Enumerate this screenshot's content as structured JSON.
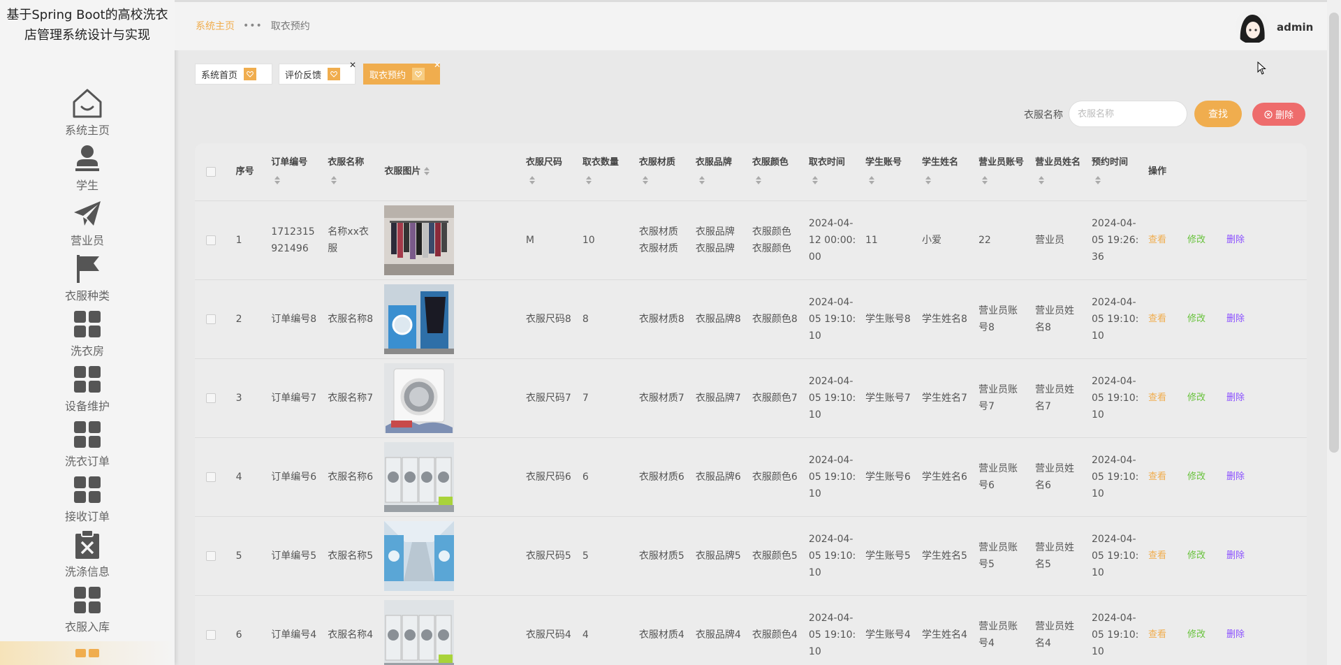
{
  "sidebar": {
    "title": "基于Spring Boot的高校洗衣店管理系统设计与实现",
    "items": [
      {
        "label": "系统主页",
        "icon": "home-icon"
      },
      {
        "label": "学生",
        "icon": "user-icon"
      },
      {
        "label": "营业员",
        "icon": "paper-plane-icon"
      },
      {
        "label": "衣服种类",
        "icon": "flag-icon"
      },
      {
        "label": "洗衣房",
        "icon": "grid-icon"
      },
      {
        "label": "设备维护",
        "icon": "grid-icon"
      },
      {
        "label": "洗衣订单",
        "icon": "grid-icon"
      },
      {
        "label": "接收订单",
        "icon": "grid-icon"
      },
      {
        "label": "洗涤信息",
        "icon": "clipboard-x-icon"
      },
      {
        "label": "衣服入库",
        "icon": "grid-icon"
      }
    ]
  },
  "header": {
    "breadcrumb_home": "系统主页",
    "breadcrumb_sep": "•••",
    "breadcrumb_current": "取衣预约",
    "username": "admin"
  },
  "tabs": [
    {
      "label": "系统首页",
      "closable": false
    },
    {
      "label": "评价反馈",
      "closable": true
    },
    {
      "label": "取衣预约",
      "closable": true,
      "active": true
    }
  ],
  "search": {
    "label": "衣服名称",
    "placeholder": "衣服名称",
    "find_label": "查找",
    "delete_label": "删除"
  },
  "table": {
    "columns": [
      "序号",
      "订单编号",
      "衣服名称",
      "衣服图片",
      "衣服尺码",
      "取衣数量",
      "衣服材质",
      "衣服品牌",
      "衣服颜色",
      "取衣时间",
      "学生账号",
      "学生姓名",
      "营业员账号",
      "营业员姓名",
      "预约时间",
      "操作"
    ],
    "actions": {
      "view": "查看",
      "edit": "修改",
      "delete": "删除"
    },
    "rows": [
      {
        "idx": "1",
        "order": "1712315921496",
        "name": "名称xx衣服",
        "img": "rack",
        "size": "M",
        "qty": "10",
        "material": "衣服材质衣服材质",
        "brand": "衣服品牌衣服品牌",
        "color": "衣服颜色衣服颜色",
        "pick": "2024-04-12 00:00:00",
        "stu_acct": "11",
        "stu_name": "小爱",
        "clerk_acct": "22",
        "clerk_name": "营业员",
        "reserve": "2024-04-05 19:26:36"
      },
      {
        "idx": "2",
        "order": "订单编号8",
        "name": "衣服名称8",
        "img": "blue-machine",
        "size": "衣服尺码8",
        "qty": "8",
        "material": "衣服材质8",
        "brand": "衣服品牌8",
        "color": "衣服颜色8",
        "pick": "2024-04-05 19:10:10",
        "stu_acct": "学生账号8",
        "stu_name": "学生姓名8",
        "clerk_acct": "营业员账号8",
        "clerk_name": "营业员姓名8",
        "reserve": "2024-04-05 19:10:10"
      },
      {
        "idx": "3",
        "order": "订单编号7",
        "name": "衣服名称7",
        "img": "white-machine",
        "size": "衣服尺码7",
        "qty": "7",
        "material": "衣服材质7",
        "brand": "衣服品牌7",
        "color": "衣服颜色7",
        "pick": "2024-04-05 19:10:10",
        "stu_acct": "学生账号7",
        "stu_name": "学生姓名7",
        "clerk_acct": "营业员账号7",
        "clerk_name": "营业员姓名7",
        "reserve": "2024-04-05 19:10:10"
      },
      {
        "idx": "4",
        "order": "订单编号6",
        "name": "衣服名称6",
        "img": "machine-row",
        "size": "衣服尺码6",
        "qty": "6",
        "material": "衣服材质6",
        "brand": "衣服品牌6",
        "color": "衣服颜色6",
        "pick": "2024-04-05 19:10:10",
        "stu_acct": "学生账号6",
        "stu_name": "学生姓名6",
        "clerk_acct": "营业员账号6",
        "clerk_name": "营业员姓名6",
        "reserve": "2024-04-05 19:10:10"
      },
      {
        "idx": "5",
        "order": "订单编号5",
        "name": "衣服名称5",
        "img": "laundry-hall",
        "size": "衣服尺码5",
        "qty": "5",
        "material": "衣服材质5",
        "brand": "衣服品牌5",
        "color": "衣服颜色5",
        "pick": "2024-04-05 19:10:10",
        "stu_acct": "学生账号5",
        "stu_name": "学生姓名5",
        "clerk_acct": "营业员账号5",
        "clerk_name": "营业员姓名5",
        "reserve": "2024-04-05 19:10:10"
      },
      {
        "idx": "6",
        "order": "订单编号4",
        "name": "衣服名称4",
        "img": "machine-row",
        "size": "衣服尺码4",
        "qty": "4",
        "material": "衣服材质4",
        "brand": "衣服品牌4",
        "color": "衣服颜色4",
        "pick": "2024-04-05 19:10:10",
        "stu_acct": "学生账号4",
        "stu_name": "学生姓名4",
        "clerk_acct": "营业员账号4",
        "clerk_name": "营业员姓名4",
        "reserve": "2024-04-05 19:10:10"
      }
    ]
  },
  "colors": {
    "accent": "#f0ad4e",
    "danger": "#ee6c6c",
    "edit": "#67c23a",
    "delete": "#8a4fff"
  }
}
